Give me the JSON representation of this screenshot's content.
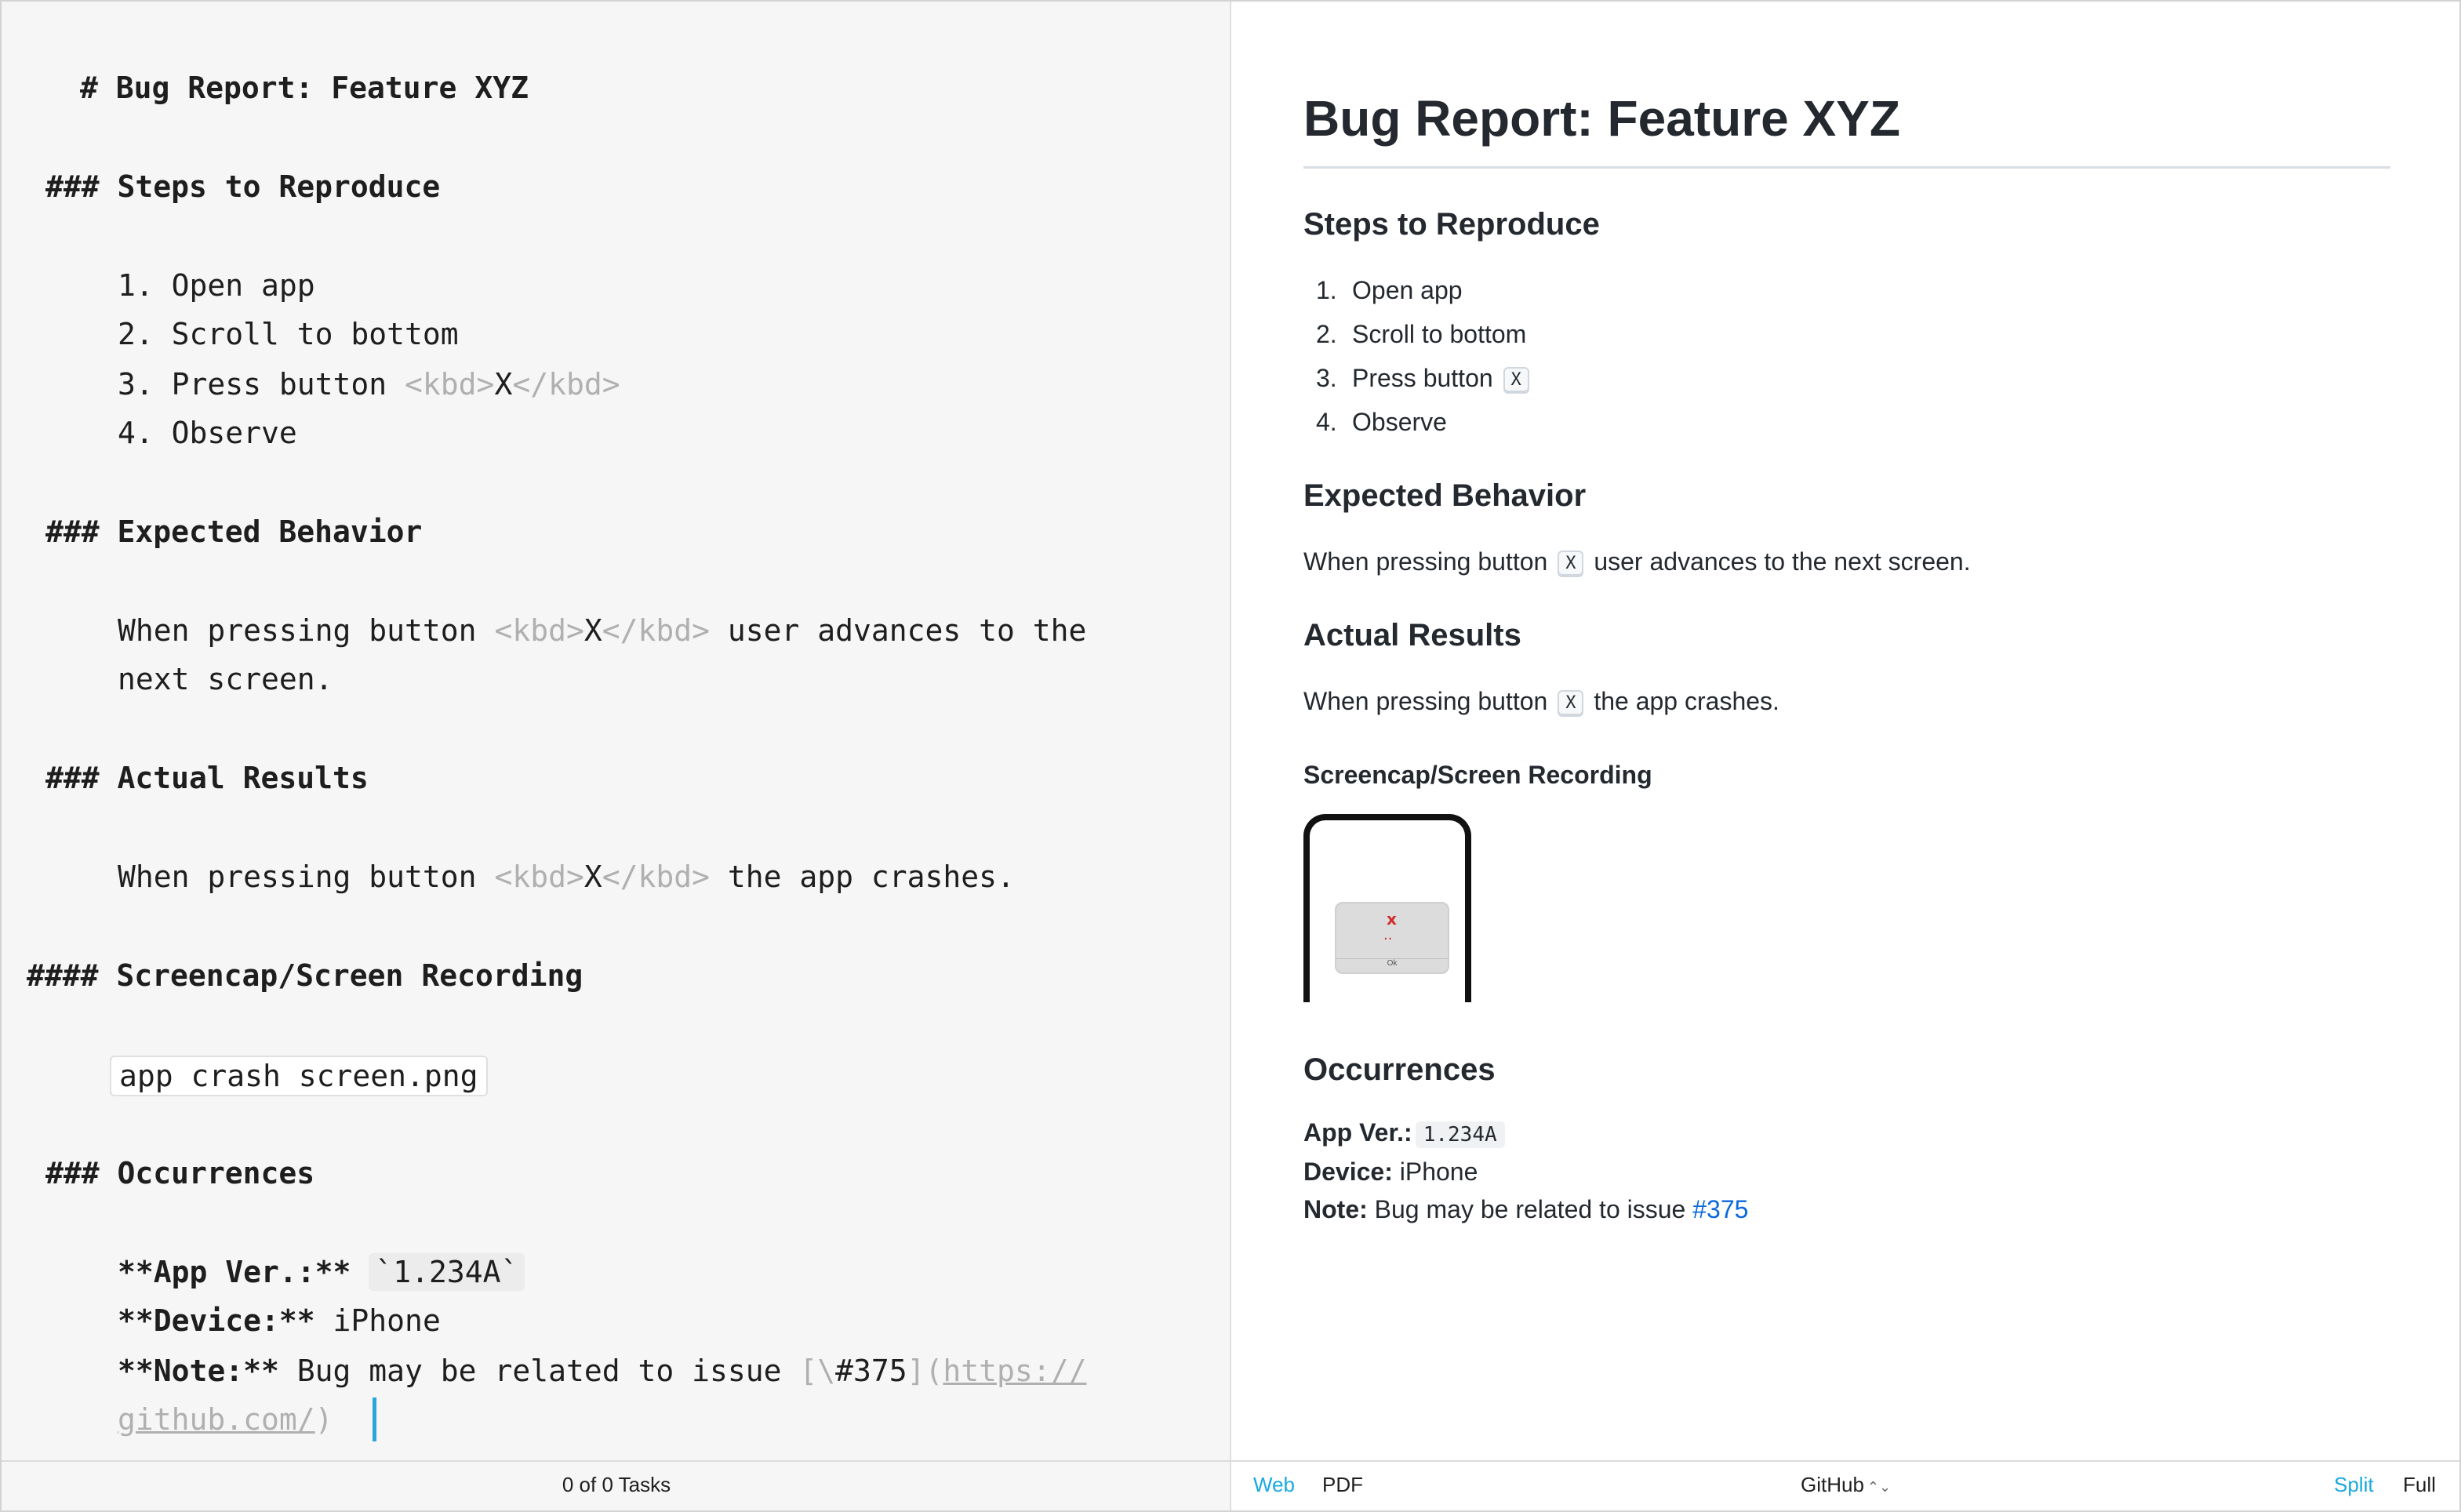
{
  "editor": {
    "lines": {
      "h1": "# Bug Report: Feature XYZ",
      "steps_heading": "### Steps to Reproduce",
      "step1": "1. Open app",
      "step2": "2. Scroll to bottom",
      "step3_text": "3. Press button ",
      "kbd_open": "<kbd>",
      "kbd_key": "X",
      "kbd_close": "</kbd>",
      "step4": "4. Observe",
      "expected_heading": "### Expected Behavior",
      "expected_pre": "When pressing button ",
      "expected_post": " user advances to the",
      "expected_line2": "next screen.",
      "actual_heading": "### Actual Results",
      "actual_pre": "When pressing button ",
      "actual_post": " the app crashes.",
      "screencap_heading": "#### Screencap/Screen Recording",
      "image_file": "app crash screen.png",
      "occ_heading": "### Occurrences",
      "appver_label": "**App Ver.:**",
      "appver_value": "`1.234A`",
      "device_label": "**Device:**",
      "device_value": " iPhone",
      "note_label": "**Note:**",
      "note_text": " Bug may be related to issue ",
      "note_link_open": "[\\",
      "note_link_text": "#375",
      "note_link_mid": "](",
      "note_url_1": "https://",
      "note_url_2": "github.com/",
      "note_link_close": ")"
    }
  },
  "preview": {
    "title": "Bug Report: Feature XYZ",
    "steps_heading": "Steps to Reproduce",
    "steps": [
      {
        "num": "1.",
        "text": "Open app"
      },
      {
        "num": "2.",
        "text": "Scroll to bottom"
      },
      {
        "num": "3.",
        "text": "Press button"
      },
      {
        "num": "4.",
        "text": "Observe"
      }
    ],
    "kbd_key": "X",
    "expected_heading": "Expected Behavior",
    "expected_pre": "When pressing button",
    "expected_post": "user advances to the next screen.",
    "actual_heading": "Actual Results",
    "actual_pre": "When pressing button",
    "actual_post": "the app crashes.",
    "screencap_heading": "Screencap/Screen Recording",
    "screenshot": {
      "x_mark": "x",
      "face": "..",
      "ok_label": "Ok"
    },
    "occ_heading": "Occurrences",
    "appver_label": "App Ver.:",
    "appver_value": "1.234A",
    "device_label": "Device:",
    "device_value": "iPhone",
    "note_label": "Note:",
    "note_text": "Bug may be related to issue",
    "note_link": "#375"
  },
  "statusbar": {
    "tasks": "0 of 0 Tasks",
    "web": "Web",
    "pdf": "PDF",
    "style": "GitHub",
    "style_arrows": "⌃⌄",
    "split": "Split",
    "full": "Full"
  },
  "colors": {
    "accent": "#19a8e0",
    "link": "#0969da",
    "markup_dim": "#b0b0b0"
  }
}
